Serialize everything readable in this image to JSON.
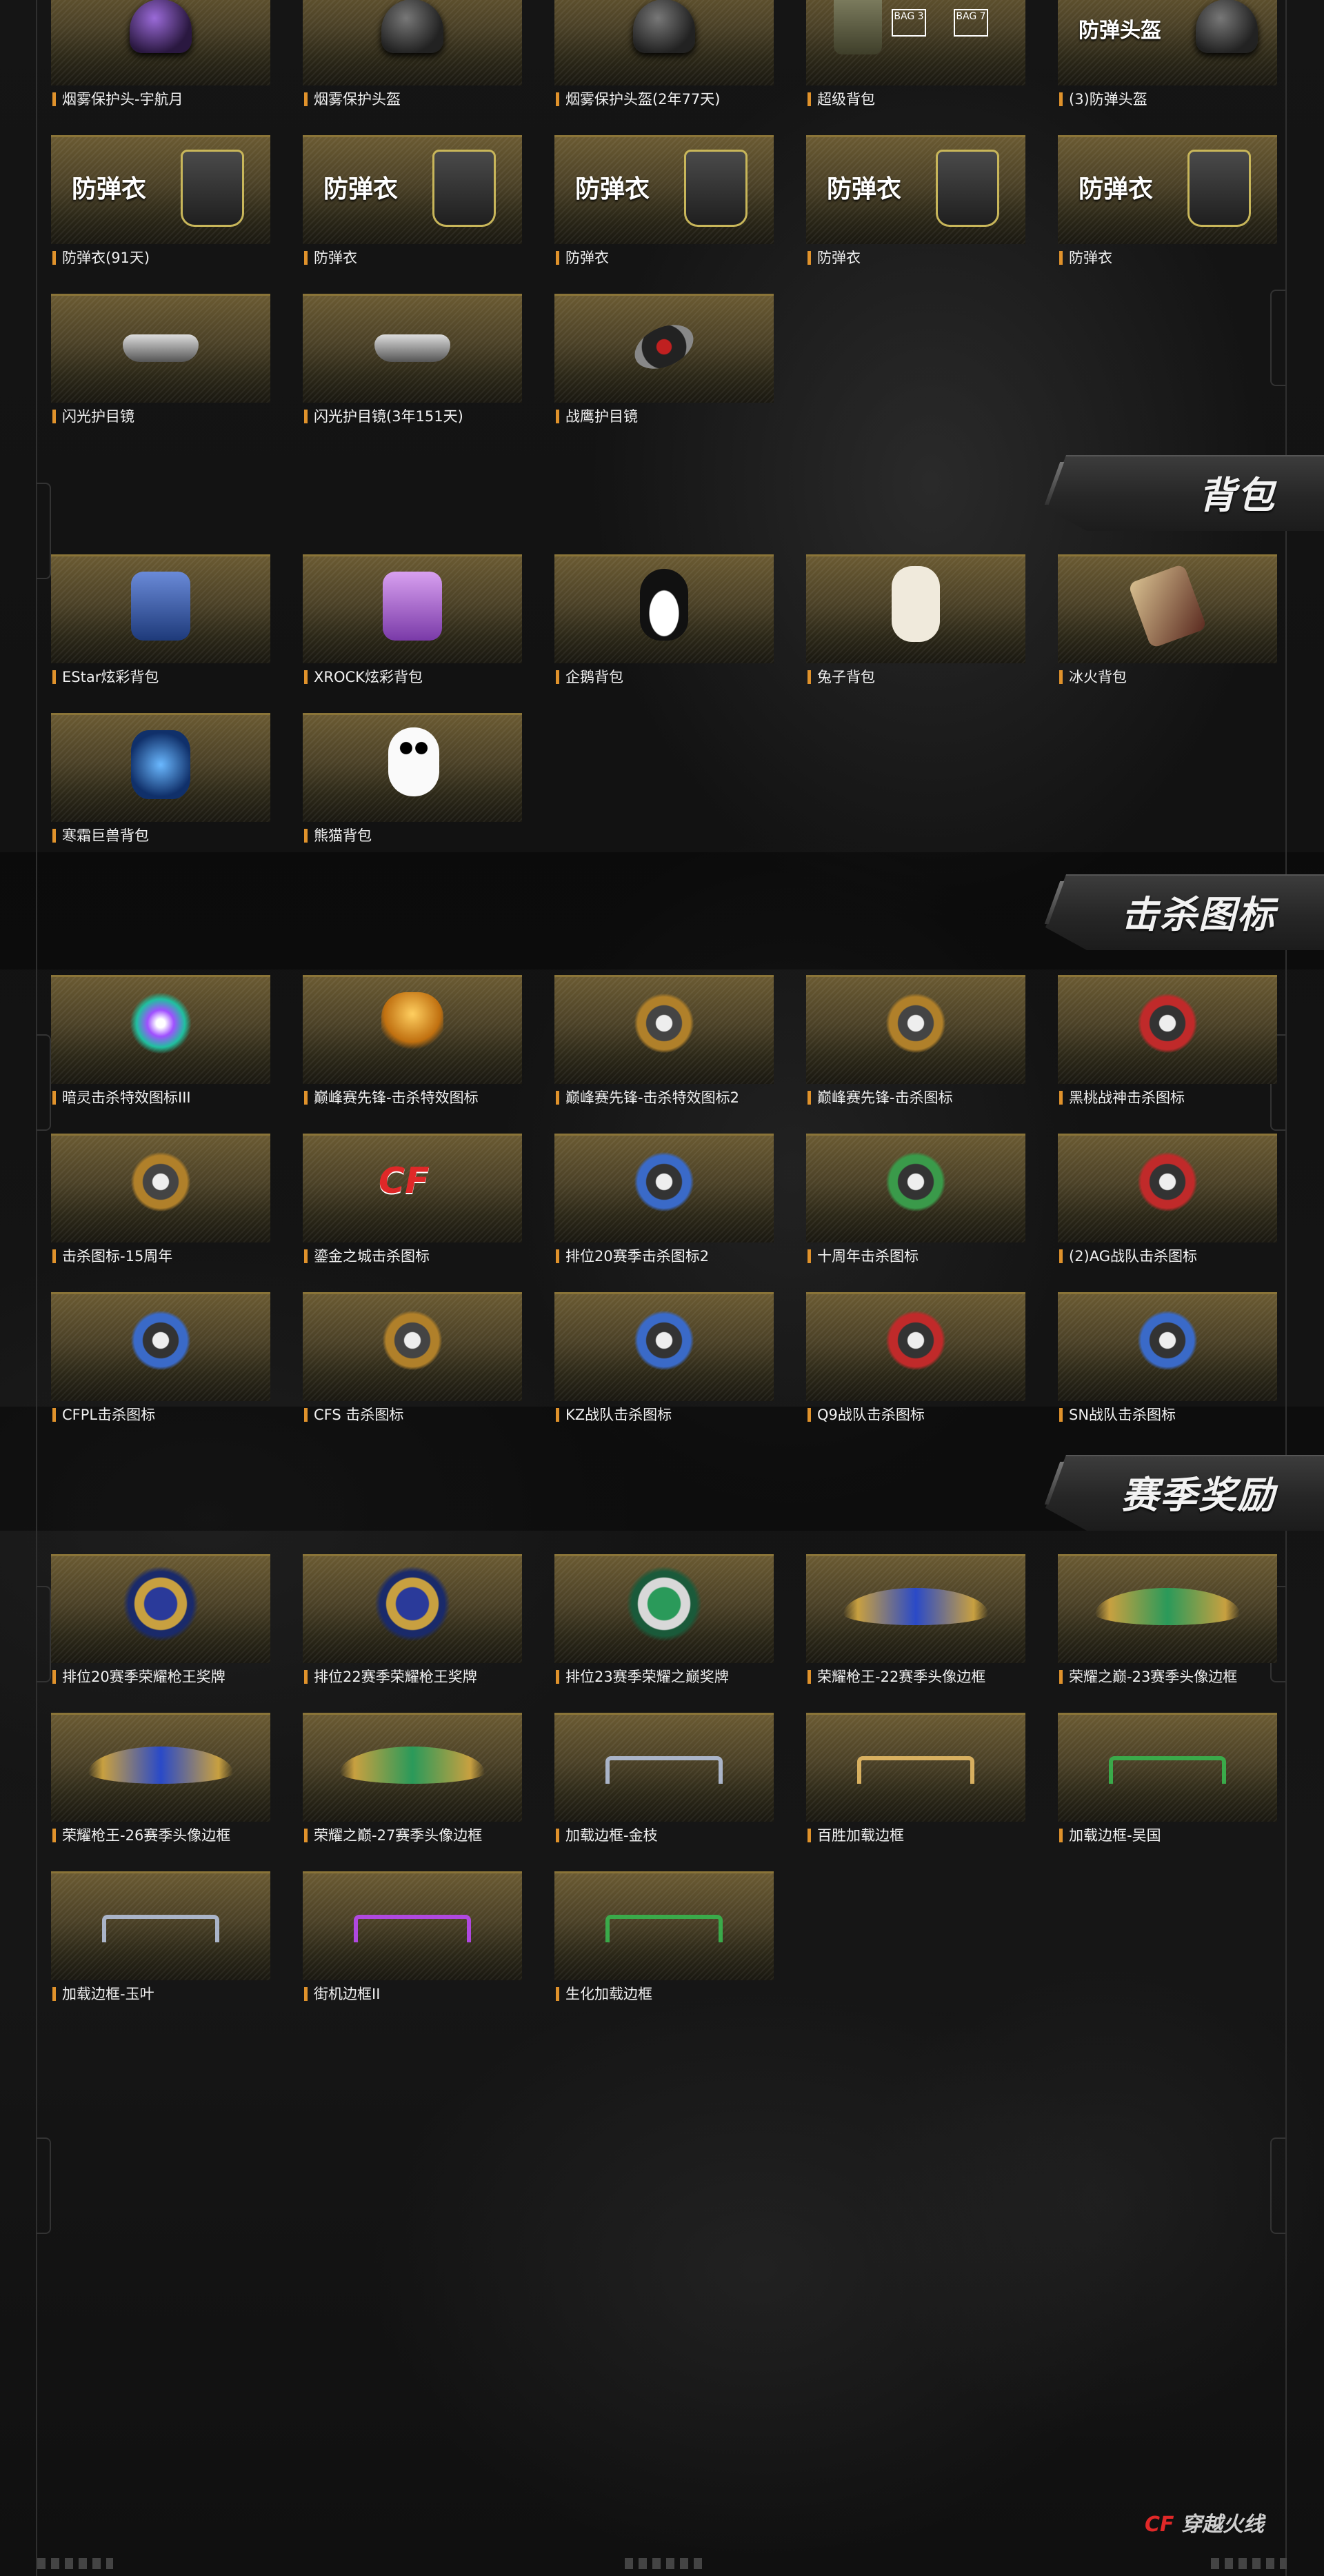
{
  "sections": [
    {
      "key": "backpack",
      "title": "背包"
    },
    {
      "key": "kill_icons",
      "title": "击杀图标"
    },
    {
      "key": "season_rewards",
      "title": "赛季奖励"
    }
  ],
  "items": {
    "gear": [
      "烟雾保护头-宇航月",
      "烟雾保护头盔",
      "烟雾保护头盔(2年77天)",
      "超级背包",
      "(3)防弹头盔",
      "防弹衣(91天)",
      "防弹衣",
      "防弹衣",
      "防弹衣",
      "防弹衣",
      "闪光护目镜",
      "闪光护目镜(3年151天)",
      "战鹰护目镜"
    ],
    "backpack": [
      "EStar炫彩背包",
      "XROCK炫彩背包",
      "企鹅背包",
      "兔子背包",
      "冰火背包",
      "寒霜巨兽背包",
      "熊猫背包"
    ],
    "kill_icons": [
      "暗灵击杀特效图标III",
      "巅峰赛先锋-击杀特效图标",
      "巅峰赛先锋-击杀特效图标2",
      "巅峰赛先锋-击杀图标",
      "黑桃战神击杀图标",
      "击杀图标-15周年",
      "鎏金之城击杀图标",
      "排位20赛季击杀图标2",
      "十周年击杀图标",
      "(2)AG战队击杀图标",
      "CFPL击杀图标",
      "CFS 击杀图标",
      "KZ战队击杀图标",
      "Q9战队击杀图标",
      "SN战队击杀图标"
    ],
    "season_rewards": [
      "排位20赛季荣耀枪王奖牌",
      "排位22赛季荣耀枪王奖牌",
      "排位23赛季荣耀之巅奖牌",
      "荣耀枪王-22赛季头像边框",
      "荣耀之巅-23赛季头像边框",
      "荣耀枪王-26赛季头像边框",
      "荣耀之巅-27赛季头像边框",
      "加载边框-金枝",
      "百胜加载边框",
      "加载边框-吴国",
      "加载边框-玉叶",
      "街机边框II",
      "生化加载边框"
    ]
  },
  "overlays": {
    "helmet_text": "防弹头盔",
    "vest_text": "防弹衣",
    "bag_badge_3": "BAG 3",
    "bag_badge_7": "BAG 7",
    "cf_mark": "CF"
  },
  "footer": {
    "logo_prefix": "CF",
    "logo_text": "穿越火线"
  }
}
